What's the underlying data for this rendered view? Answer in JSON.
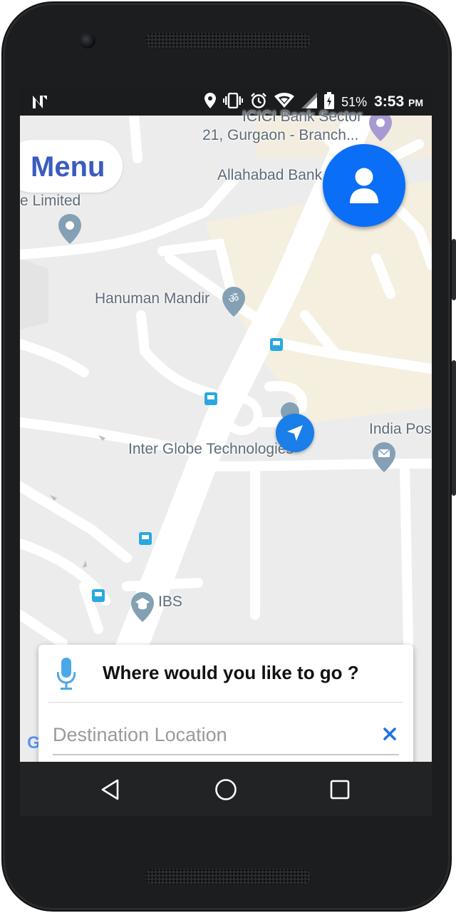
{
  "status_bar": {
    "battery_percent": "51%",
    "time": "3:53",
    "time_suffix": "PM",
    "icons": [
      "n-logo-icon",
      "location-pin-icon",
      "vibrate-icon",
      "alarm-icon",
      "wifi-icon",
      "signal-icon",
      "battery-icon"
    ]
  },
  "map": {
    "labels": {
      "bank_line1": "ICICI Bank Sector",
      "bank_line2": "21, Gurgaon -  Branch...",
      "allahabad": "Allahabad Bank",
      "limited": "e Limited",
      "hanuman": "Hanuman Mandir",
      "interglobe": "Inter Globe Technologies",
      "india_post": "India Pos",
      "ibs": "IBS"
    },
    "attribution": "Google"
  },
  "menu": {
    "label": "Menu"
  },
  "search_card": {
    "title": "Where would you like to go ?",
    "destination_placeholder": "Destination Location",
    "destination_value": ""
  },
  "colors": {
    "accent_blue": "#0b6ef6",
    "menu_text": "#3a5bbf",
    "clear_icon": "#1a73e8",
    "mic_icon": "#4aa8e8"
  }
}
